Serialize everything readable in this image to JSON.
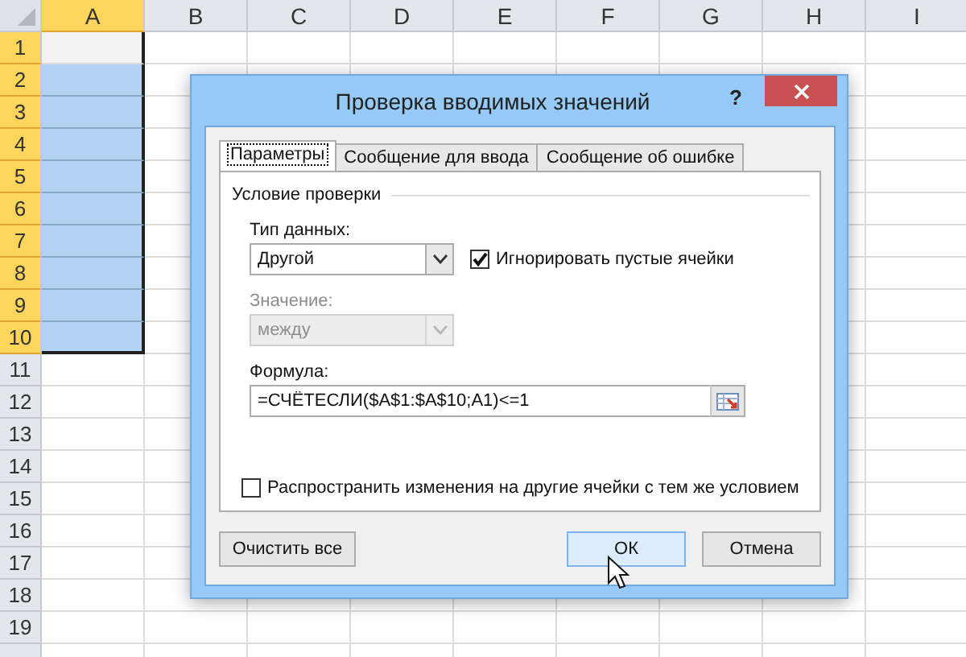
{
  "sheet": {
    "columns": [
      {
        "label": "A",
        "selected": true
      },
      {
        "label": "B",
        "selected": false
      },
      {
        "label": "C",
        "selected": false
      },
      {
        "label": "D",
        "selected": false
      },
      {
        "label": "E",
        "selected": false
      },
      {
        "label": "F",
        "selected": false
      },
      {
        "label": "G",
        "selected": false
      },
      {
        "label": "H",
        "selected": false
      },
      {
        "label": "I",
        "selected": false
      }
    ],
    "rows": [
      {
        "label": "1",
        "selected": true,
        "active": true
      },
      {
        "label": "2",
        "selected": true,
        "active": false
      },
      {
        "label": "3",
        "selected": true,
        "active": false
      },
      {
        "label": "4",
        "selected": true,
        "active": false
      },
      {
        "label": "5",
        "selected": true,
        "active": false
      },
      {
        "label": "6",
        "selected": true,
        "active": false
      },
      {
        "label": "7",
        "selected": true,
        "active": false
      },
      {
        "label": "8",
        "selected": true,
        "active": false
      },
      {
        "label": "9",
        "selected": true,
        "active": false
      },
      {
        "label": "10",
        "selected": true,
        "active": false
      },
      {
        "label": "11",
        "selected": false,
        "active": false
      },
      {
        "label": "12",
        "selected": false,
        "active": false
      },
      {
        "label": "13",
        "selected": false,
        "active": false
      },
      {
        "label": "14",
        "selected": false,
        "active": false
      },
      {
        "label": "15",
        "selected": false,
        "active": false
      },
      {
        "label": "16",
        "selected": false,
        "active": false
      },
      {
        "label": "17",
        "selected": false,
        "active": false
      },
      {
        "label": "18",
        "selected": false,
        "active": false
      },
      {
        "label": "19",
        "selected": false,
        "active": false
      }
    ]
  },
  "dialog": {
    "title": "Проверка вводимых значений",
    "help": "?",
    "tabs": [
      {
        "label": "Параметры",
        "selected": true
      },
      {
        "label": "Сообщение для ввода",
        "selected": false
      },
      {
        "label": "Сообщение об ошибке",
        "selected": false
      }
    ],
    "group_title": "Условие проверки",
    "data_type": {
      "label": "Тип данных:",
      "value": "Другой",
      "disabled": false
    },
    "ignore_blank": {
      "label": "Игнорировать пустые ячейки",
      "checked": true
    },
    "value_field": {
      "label": "Значение:",
      "value": "между",
      "disabled": true
    },
    "formula": {
      "label": "Формула:",
      "value": "=СЧЁТЕСЛИ($A$1:$A$10;A1)<=1"
    },
    "apply_all": {
      "label": "Распространить изменения на другие ячейки с тем же условием",
      "checked": false
    },
    "buttons": [
      {
        "label": "Очистить все",
        "kind": "left",
        "hovered": false
      },
      {
        "label": "ОК",
        "kind": "right",
        "hovered": true
      },
      {
        "label": "Отмена",
        "kind": "right",
        "hovered": false
      }
    ]
  }
}
